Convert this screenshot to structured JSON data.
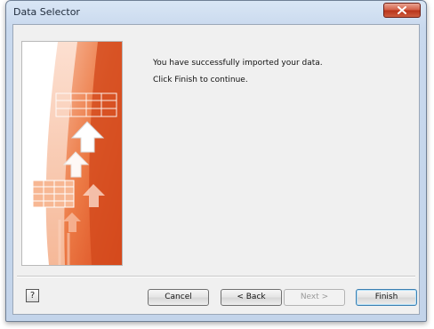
{
  "window": {
    "title": "Data Selector"
  },
  "message": {
    "line1": "You have successfully imported your data.",
    "line2": "Click Finish to continue."
  },
  "buttons": {
    "help": "?",
    "cancel": "Cancel",
    "back": "< Back",
    "next": "Next >",
    "finish": "Finish"
  },
  "colors": {
    "accent_orange": "#e8622f",
    "close_red": "#c8452c"
  }
}
